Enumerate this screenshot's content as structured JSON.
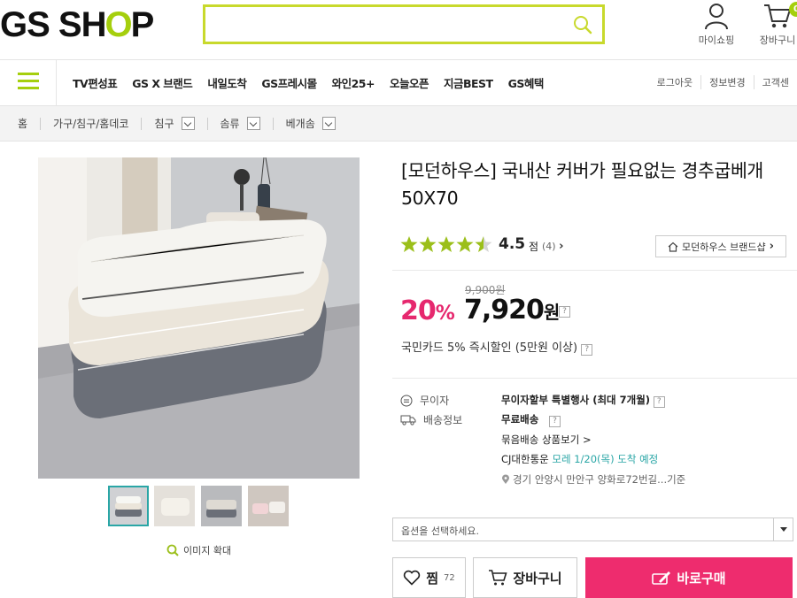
{
  "header": {
    "logo_left": "GS SH",
    "logo_o": "O",
    "logo_right": "P",
    "search_value": "",
    "my_shopping": "마이쇼핑",
    "cart": "장바구니",
    "cart_count": "0"
  },
  "nav": {
    "items": [
      "TV편성표",
      "GS X 브랜드",
      "내일도착",
      "GS프레시몰",
      "와인25+",
      "오늘오픈",
      "지금BEST",
      "GS혜택"
    ],
    "right": [
      "로그아웃",
      "정보변경",
      "고객센"
    ]
  },
  "breadcrumb": {
    "home": "홈",
    "cat1": "가구/침구/홈데코",
    "cat2": "침구",
    "cat3": "솜류",
    "cat4": "베개솜"
  },
  "gallery": {
    "zoom_label": "이미지 확대"
  },
  "product": {
    "title": "[모던하우스] 국내산 커버가 필요없는 경추굽베개 50X70",
    "rating": "4.5",
    "rating_value": 4.5,
    "rating_unit": "점",
    "review_count": "(4)",
    "brandshop": "모던하우스 브랜드샵",
    "original_price": "9,900원",
    "discount_num": "20",
    "discount_pct": "%",
    "price_num": "7,920",
    "price_unit": "원",
    "card_discount": "국민카드 5% 즉시할인 (5만원 이상)"
  },
  "info": {
    "installment_label": "무이자",
    "installment_value": "무이자할부 특별행사 (최대 7개월)",
    "delivery_label": "배송정보",
    "free_delivery": "무료배송",
    "bundle": "묶음배송 상품보기 >",
    "courier": "CJ대한통운",
    "arrival": "모레 1/20(목) 도착 예정",
    "address": "경기 안양시 만안구 양화로72번길...기준"
  },
  "purchase": {
    "option_placeholder": "옵션을 선택하세요.",
    "wish_label": "찜",
    "wish_count": "72",
    "cart_label": "장바구니",
    "buy_label": "바로구매"
  },
  "colors": {
    "brand_green": "#a5cf0d",
    "accent_pink": "#ee2c6e",
    "star_green": "#9bbf1a"
  }
}
